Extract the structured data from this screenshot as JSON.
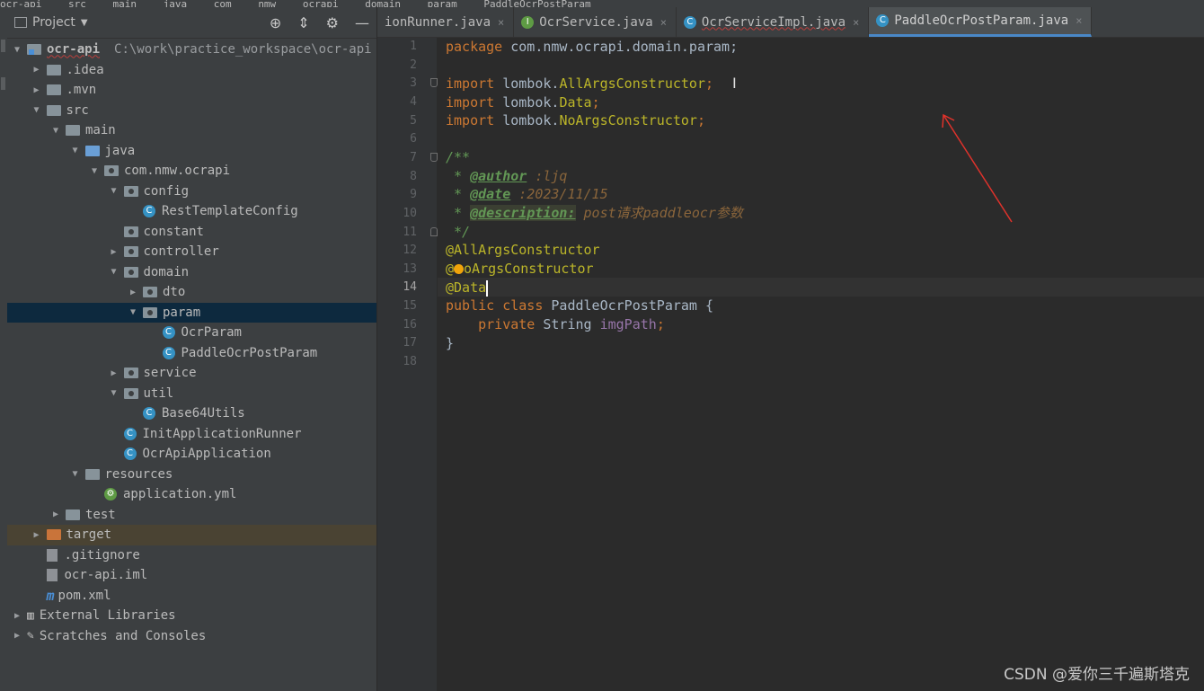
{
  "breadcrumb": [
    "ocr-api",
    "src",
    "main",
    "java",
    "com",
    "nmw",
    "ocrapi",
    "domain",
    "param",
    "PaddleOcrPostParam"
  ],
  "project_panel": {
    "title": "Project",
    "tree": [
      {
        "label": "ocr-api",
        "path": "C:\\work\\practice_workspace\\ocr-api",
        "depth": 0,
        "expanded": true,
        "icon": "module-folder-icon"
      },
      {
        "label": ".idea",
        "depth": 1,
        "expanded": false,
        "icon": "folder-icon"
      },
      {
        "label": ".mvn",
        "depth": 1,
        "expanded": false,
        "icon": "folder-icon"
      },
      {
        "label": "src",
        "depth": 1,
        "expanded": true,
        "icon": "folder-icon"
      },
      {
        "label": "main",
        "depth": 2,
        "expanded": true,
        "icon": "folder-icon"
      },
      {
        "label": "java",
        "depth": 3,
        "expanded": true,
        "icon": "source-folder-icon"
      },
      {
        "label": "com.nmw.ocrapi",
        "depth": 4,
        "expanded": true,
        "icon": "package-icon"
      },
      {
        "label": "config",
        "depth": 5,
        "expanded": true,
        "icon": "package-icon"
      },
      {
        "label": "RestTemplateConfig",
        "depth": 6,
        "icon": "class-icon"
      },
      {
        "label": "constant",
        "depth": 5,
        "icon": "package-icon"
      },
      {
        "label": "controller",
        "depth": 5,
        "expanded": false,
        "icon": "package-icon"
      },
      {
        "label": "domain",
        "depth": 5,
        "expanded": true,
        "icon": "package-icon"
      },
      {
        "label": "dto",
        "depth": 6,
        "expanded": false,
        "icon": "package-icon"
      },
      {
        "label": "param",
        "depth": 6,
        "expanded": true,
        "icon": "package-icon",
        "selected": true
      },
      {
        "label": "OcrParam",
        "depth": 7,
        "icon": "class-icon"
      },
      {
        "label": "PaddleOcrPostParam",
        "depth": 7,
        "icon": "class-icon"
      },
      {
        "label": "service",
        "depth": 5,
        "expanded": false,
        "icon": "package-icon"
      },
      {
        "label": "util",
        "depth": 5,
        "expanded": true,
        "icon": "package-icon"
      },
      {
        "label": "Base64Utils",
        "depth": 6,
        "icon": "class-icon"
      },
      {
        "label": "InitApplicationRunner",
        "depth": 5,
        "icon": "class-icon"
      },
      {
        "label": "OcrApiApplication",
        "depth": 5,
        "icon": "class-icon"
      },
      {
        "label": "resources",
        "depth": 3,
        "expanded": true,
        "icon": "resources-folder-icon"
      },
      {
        "label": "application.yml",
        "depth": 4,
        "icon": "yml-file-icon"
      },
      {
        "label": "test",
        "depth": 2,
        "expanded": false,
        "icon": "folder-icon"
      },
      {
        "label": "target",
        "depth": 1,
        "expanded": false,
        "icon": "excluded-folder-icon",
        "highlight": true
      },
      {
        "label": ".gitignore",
        "depth": 1,
        "icon": "file-icon"
      },
      {
        "label": "ocr-api.iml",
        "depth": 1,
        "icon": "file-icon"
      },
      {
        "label": "pom.xml",
        "depth": 1,
        "icon": "maven-icon"
      },
      {
        "label": "External Libraries",
        "depth": 0,
        "expanded": false,
        "icon": "library-icon"
      },
      {
        "label": "Scratches and Consoles",
        "depth": 0,
        "expanded": false,
        "icon": "scratches-icon"
      }
    ]
  },
  "tabs": [
    {
      "label": "ionRunner.java",
      "icon": "class-icon",
      "active": false
    },
    {
      "label": "OcrService.java",
      "icon": "interface-icon",
      "active": false
    },
    {
      "label": "OcrServiceImpl.java",
      "icon": "class-icon",
      "active": false
    },
    {
      "label": "PaddleOcrPostParam.java",
      "icon": "class-icon",
      "active": true
    }
  ],
  "editor": {
    "current_line": 14,
    "line_numbers": [
      "1",
      "2",
      "3",
      "4",
      "5",
      "6",
      "7",
      "8",
      "9",
      "10",
      "11",
      "12",
      "13",
      "14",
      "15",
      "16",
      "17",
      "18"
    ],
    "code": {
      "l1_kw": "package",
      "l1_rest": " com.nmw.ocrapi.domain.param;",
      "l3_kw": "import",
      "l3_pkg": " lombok.",
      "l3_cls": "AllArgsConstructor",
      "l3_semi": ";",
      "l4_kw": "import",
      "l4_pkg": " lombok.",
      "l4_cls": "Data",
      "l4_semi": ";",
      "l5_kw": "import",
      "l5_pkg": " lombok.",
      "l5_cls": "NoArgsConstructor",
      "l5_semi": ";",
      "l7": "/**",
      "l8_star": " * ",
      "l8_tag": "@author",
      "l8_val": " :ljq",
      "l9_star": " * ",
      "l9_tag": "@date",
      "l9_val": " :2023/11/15",
      "l10_star": " * ",
      "l10_tag": "@description:",
      "l10_val": " post请求paddleocr参数",
      "l11": " */",
      "l12": "@AllArgsConstructor",
      "l13_a": "@",
      "l13_b": "oArgsConstructor",
      "l14": "@Data",
      "l15_kw": "public class",
      "l15_rest": " PaddleOcrPostParam {",
      "l16_kw": "    private",
      "l16_type": " String ",
      "l16_field": "imgPath",
      "l16_semi": ";",
      "l17": "}"
    }
  },
  "watermark": "CSDN @爱你三千遍斯塔克",
  "colors": {
    "keyword": "#cc7832",
    "annotation": "#bbb529",
    "doc": "#629755",
    "field": "#9876aa",
    "arrow": "#e0322b"
  }
}
